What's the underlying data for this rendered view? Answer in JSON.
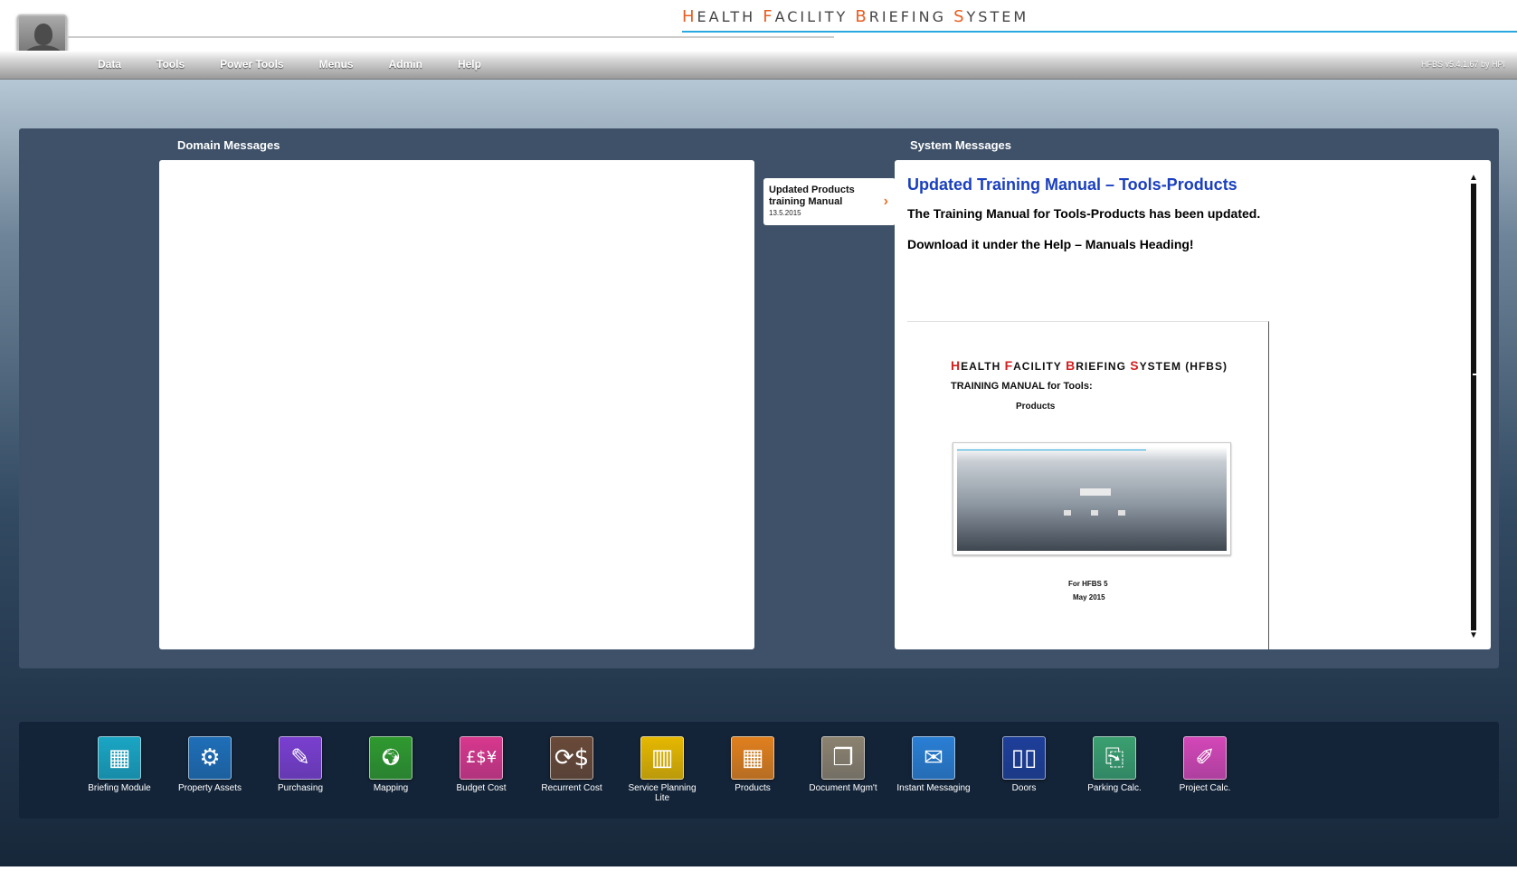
{
  "header": {
    "title_parts": [
      {
        "accent": "H",
        "rest": "EALTH "
      },
      {
        "accent": "F",
        "rest": "ACILITY "
      },
      {
        "accent": "B",
        "rest": "RIEFING "
      },
      {
        "accent": "S",
        "rest": "YSTEM"
      }
    ],
    "version": "HFBS v5.4.1.67 by HPI"
  },
  "nav": {
    "items": [
      "Data",
      "Tools",
      "Power Tools",
      "Menus",
      "Admin",
      "Help"
    ]
  },
  "domain_messages": {
    "label": "Domain Messages"
  },
  "system_messages": {
    "label": "System Messages",
    "list_item": {
      "title": "Updated Products training Manual",
      "date": "13.5.2015"
    },
    "heading": "Updated Training Manual – Tools-Products",
    "line1": "The Training Manual for Tools-Products has been updated.",
    "line2": "Download it under the Help – Manuals Heading!",
    "manual": {
      "title_parts": [
        {
          "accent": "H",
          "rest": "EALTH "
        },
        {
          "accent": "F",
          "rest": "ACILITY "
        },
        {
          "accent": "B",
          "rest": "RIEFING "
        },
        {
          "accent": "S",
          "rest": "YSTEM (HFBS)"
        }
      ],
      "subtitle": "TRAINING MANUAL for Tools:",
      "topic": "Products",
      "for_version": "For HFBS 5",
      "date": "May 2015"
    }
  },
  "apps": [
    {
      "label": "Briefing Module",
      "color": "#1aa6c4",
      "icon": "briefing-icon",
      "glyph": "▦"
    },
    {
      "label": "Property Assets",
      "color": "#1f6fb8",
      "icon": "gears-icon",
      "glyph": "⚙"
    },
    {
      "label": "Purchasing",
      "color": "#7a3fd0",
      "icon": "purchasing-icon",
      "glyph": "✎"
    },
    {
      "label": "Mapping",
      "color": "#2f9a2f",
      "icon": "map-icon",
      "glyph": "🌍︎"
    },
    {
      "label": "Budget Cost",
      "color": "#d8388e",
      "icon": "currency-icon",
      "glyph": "£$¥"
    },
    {
      "label": "Recurrent Cost",
      "color": "#6a4a38",
      "icon": "recurrent-cost-icon",
      "glyph": "⟳$"
    },
    {
      "label": "Service Planning Lite",
      "color": "#e6b800",
      "icon": "bar-chart-icon",
      "glyph": "▥"
    },
    {
      "label": "Products",
      "color": "#e0801e",
      "icon": "boxes-icon",
      "glyph": "▦"
    },
    {
      "label": "Document Mgm't",
      "color": "#8c8270",
      "icon": "documents-icon",
      "glyph": "❐"
    },
    {
      "label": "Instant Messaging",
      "color": "#2a7fd4",
      "icon": "chat-icon",
      "glyph": "✉"
    },
    {
      "label": "Doors",
      "color": "#1e3f9a",
      "icon": "door-icon",
      "glyph": "▯▯"
    },
    {
      "label": "Parking Calc.",
      "color": "#3aa070",
      "icon": "parking-icon",
      "glyph": "⎘"
    },
    {
      "label": "Project Calc.",
      "color": "#d447b8",
      "icon": "project-calc-icon",
      "glyph": "✐"
    }
  ]
}
